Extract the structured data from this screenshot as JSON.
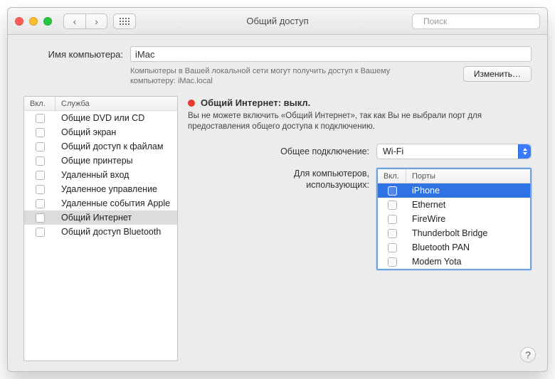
{
  "titlebar": {
    "title": "Общий доступ",
    "search_placeholder": "Поиск"
  },
  "computer_name": {
    "label": "Имя компьютера:",
    "value": "iMac",
    "hint_line1": "Компьютеры в Вашей локальной сети могут получить доступ к Вашему",
    "hint_line2": "компьютеру: iMac.local",
    "edit_button": "Изменить…"
  },
  "services": {
    "header_on": "Вкл.",
    "header_name": "Служба",
    "items": [
      {
        "label": "Общие DVD или CD",
        "on": false,
        "selected": false
      },
      {
        "label": "Общий экран",
        "on": false,
        "selected": false
      },
      {
        "label": "Общий доступ к файлам",
        "on": false,
        "selected": false
      },
      {
        "label": "Общие принтеры",
        "on": false,
        "selected": false
      },
      {
        "label": "Удаленный вход",
        "on": false,
        "selected": false
      },
      {
        "label": "Удаленное управление",
        "on": false,
        "selected": false
      },
      {
        "label": "Удаленные события Apple",
        "on": false,
        "selected": false
      },
      {
        "label": "Общий Интернет",
        "on": false,
        "selected": true
      },
      {
        "label": "Общий доступ Bluetooth",
        "on": false,
        "selected": false
      }
    ]
  },
  "detail": {
    "status_title": "Общий Интернет: выкл.",
    "explain": "Вы не можете включить «Общий Интернет», так как Вы не выбрали порт для предоставления общего доступа к подключению.",
    "share_from_label": "Общее подключение:",
    "share_from_value": "Wi-Fi",
    "to_label_line1": "Для компьютеров,",
    "to_label_line2": "использующих:",
    "ports_header_on": "Вкл.",
    "ports_header_name": "Порты",
    "ports": [
      {
        "label": "iPhone",
        "on": false,
        "selected": true
      },
      {
        "label": "Ethernet",
        "on": false,
        "selected": false
      },
      {
        "label": "FireWire",
        "on": false,
        "selected": false
      },
      {
        "label": "Thunderbolt Bridge",
        "on": false,
        "selected": false
      },
      {
        "label": "Bluetooth PAN",
        "on": false,
        "selected": false
      },
      {
        "label": "Modem Yota",
        "on": false,
        "selected": false
      }
    ]
  },
  "help_glyph": "?"
}
